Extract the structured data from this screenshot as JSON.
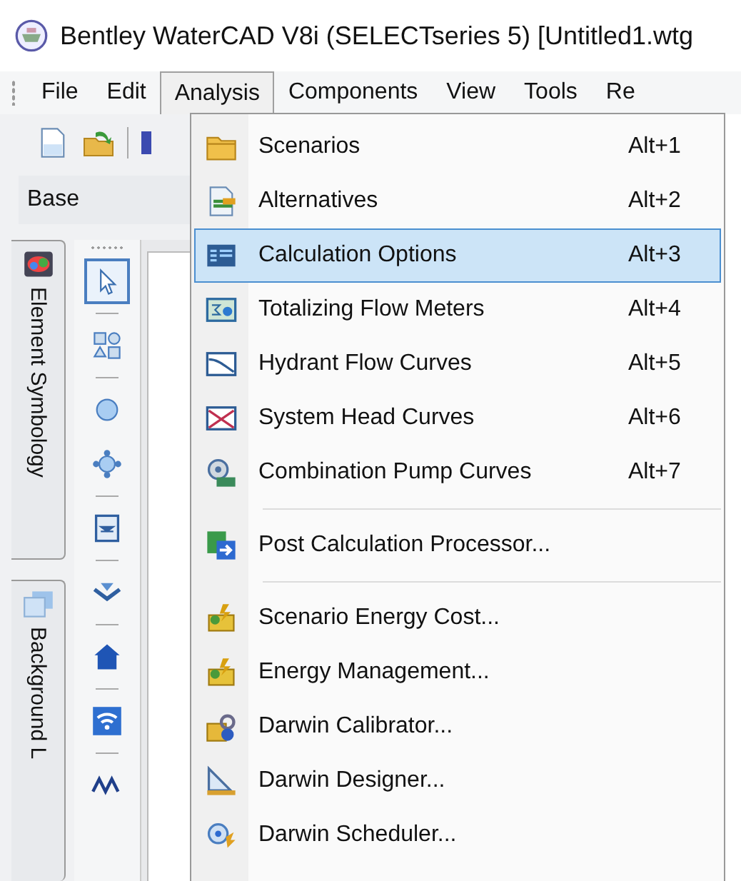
{
  "title_bar": {
    "title": "Bentley WaterCAD V8i (SELECTseries 5) [Untitled1.wtg"
  },
  "menu_bar": [
    {
      "label": "File",
      "selected": false
    },
    {
      "label": "Edit",
      "selected": false
    },
    {
      "label": "Analysis",
      "selected": true
    },
    {
      "label": "Components",
      "selected": false
    },
    {
      "label": "View",
      "selected": false
    },
    {
      "label": "Tools",
      "selected": false
    },
    {
      "label": "Re",
      "selected": false
    }
  ],
  "scenario_field": {
    "value": "Base"
  },
  "side_tabs": [
    {
      "label": "Element Symbology"
    },
    {
      "label": "Background L"
    }
  ],
  "palette": [
    {
      "kind": "pointer",
      "selected": true
    },
    {
      "kind": "shapes",
      "selected": false
    },
    {
      "kind": "circle",
      "selected": false
    },
    {
      "kind": "node",
      "selected": false
    },
    {
      "kind": "tank",
      "selected": false
    },
    {
      "kind": "valve",
      "selected": false
    },
    {
      "kind": "house",
      "selected": false
    },
    {
      "kind": "wifi",
      "selected": false
    },
    {
      "kind": "zigzag",
      "selected": false
    }
  ],
  "menu": {
    "sections": [
      {
        "items": [
          {
            "label": "Scenarios",
            "shortcut": "Alt+1",
            "selected": false
          },
          {
            "label": "Alternatives",
            "shortcut": "Alt+2",
            "selected": false
          },
          {
            "label": "Calculation Options",
            "shortcut": "Alt+3",
            "selected": true
          },
          {
            "label": "Totalizing Flow Meters",
            "shortcut": "Alt+4",
            "selected": false
          },
          {
            "label": "Hydrant Flow Curves",
            "shortcut": "Alt+5",
            "selected": false
          },
          {
            "label": "System Head Curves",
            "shortcut": "Alt+6",
            "selected": false
          },
          {
            "label": "Combination Pump Curves",
            "shortcut": "Alt+7",
            "selected": false
          }
        ]
      },
      {
        "items": [
          {
            "label": "Post Calculation Processor...",
            "selected": false
          }
        ]
      },
      {
        "items": [
          {
            "label": "Scenario Energy Cost...",
            "selected": false
          },
          {
            "label": "Energy Management...",
            "selected": false
          },
          {
            "label": "Darwin Calibrator...",
            "selected": false
          },
          {
            "label": "Darwin Designer...",
            "selected": false
          },
          {
            "label": "Darwin Scheduler...",
            "selected": false
          }
        ]
      }
    ]
  }
}
